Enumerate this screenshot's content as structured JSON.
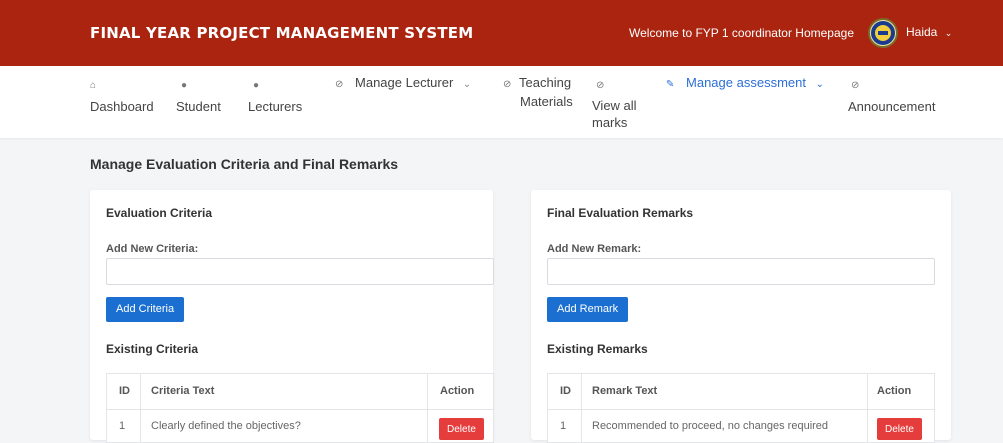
{
  "header": {
    "title": "FINAL YEAR PROJECT MANAGEMENT SYSTEM",
    "welcome": "Welcome to FYP 1 coordinator Homepage",
    "user_name": "Haida",
    "user_chevron_icon": "chevron-down-icon"
  },
  "nav": {
    "items": [
      {
        "label1": "",
        "label2": "Dashboard",
        "icon": "home-icon"
      },
      {
        "label1": "",
        "label2": "Student",
        "icon": "users-icon"
      },
      {
        "label1": "",
        "label2": "Lecturers",
        "icon": "users-icon"
      },
      {
        "label1": "Manage Lecturer",
        "label2": "",
        "icon": "circle-icon"
      },
      {
        "label1": "Teaching",
        "label2": "Materials",
        "icon": "circle-icon"
      },
      {
        "label1": "View all",
        "label2": "marks",
        "icon": "circle-icon"
      },
      {
        "label1": "Manage assessment",
        "label2": "",
        "icon": "pencil-icon"
      },
      {
        "label1": "",
        "label2": "Announcement",
        "icon": "circle-icon"
      }
    ],
    "active_color": "#2c6fd6"
  },
  "page": {
    "title": "Manage Evaluation Criteria and Final Remarks"
  },
  "criteria": {
    "card_title": "Evaluation Criteria",
    "add_label": "Add New Criteria:",
    "input_value": "",
    "add_button": "Add Criteria",
    "existing_title": "Existing Criteria",
    "columns": [
      "ID",
      "Criteria Text",
      "Action"
    ],
    "rows": [
      {
        "id": "1",
        "text": "Clearly defined the objectives?",
        "action": "Delete"
      }
    ]
  },
  "remarks": {
    "card_title": "Final Evaluation Remarks",
    "add_label": "Add New Remark:",
    "input_value": "",
    "add_button": "Add Remark",
    "existing_title": "Existing Remarks",
    "columns": [
      "ID",
      "Remark Text",
      "Action"
    ],
    "rows": [
      {
        "id": "1",
        "text": "Recommended to proceed, no changes required",
        "action": "Delete"
      }
    ]
  },
  "colors": {
    "header_bg": "#aa2410",
    "primary_button": "#1a6fd0",
    "danger_button": "#e53c3c"
  }
}
